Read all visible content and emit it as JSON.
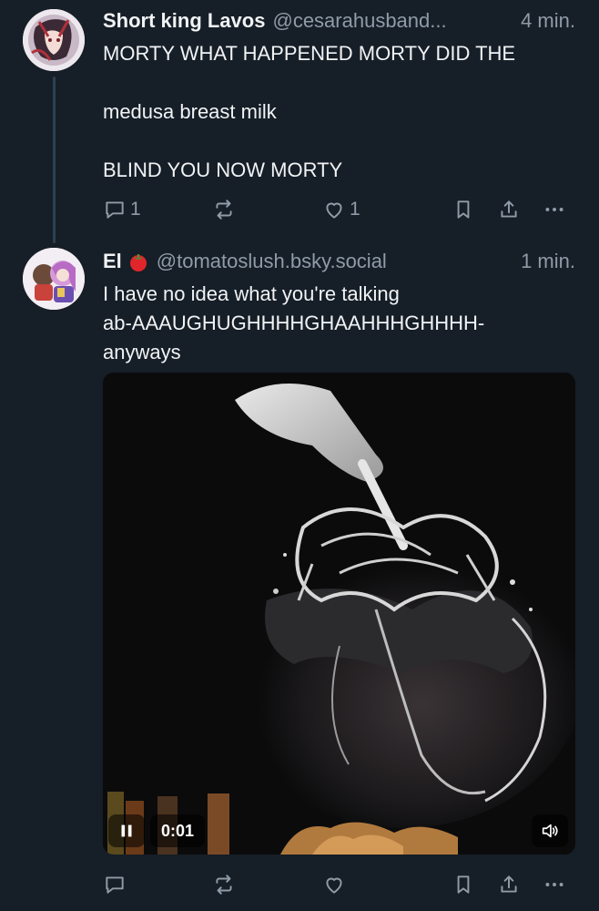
{
  "colors": {
    "background": "#161e27",
    "text": "#f1f3f5",
    "muted": "#8f9ca8",
    "thread_line": "#2e4052"
  },
  "posts": [
    {
      "display_name": "Short king Lavos",
      "handle": "@cesarahusband...",
      "time": "4 min.",
      "lines": [
        "MORTY WHAT HAPPENED MORTY DID THE",
        "",
        "medusa breast milk",
        "",
        "BLIND YOU NOW MORTY"
      ],
      "reply_count": "1",
      "repost_count": "",
      "like_count": "1"
    },
    {
      "display_name": "El",
      "name_emoji": "tomato-emoji",
      "handle": "@tomatoslush.bsky.social",
      "time": "1 min.",
      "lines": [
        "I have no idea what you're talking",
        "ab-AAAUGHUGHHHHGHAAHHHGHHHH-",
        "anyways"
      ],
      "video": {
        "timecode": "0:01",
        "state": "playing"
      },
      "reply_count": "",
      "repost_count": "",
      "like_count": ""
    }
  ],
  "icons": {
    "reply": "speech-bubble-icon",
    "repost": "repost-icon",
    "like": "heart-icon",
    "bookmark": "bookmark-icon",
    "share": "share-icon",
    "more": "more-dots-icon",
    "pause": "pause-icon",
    "volume": "volume-icon"
  }
}
